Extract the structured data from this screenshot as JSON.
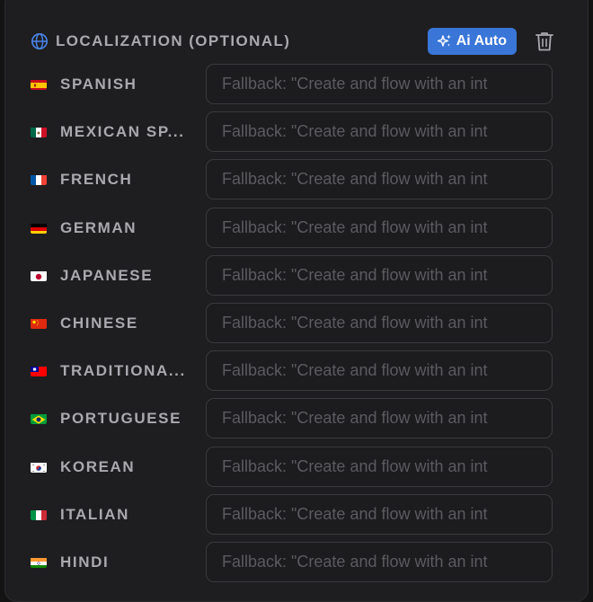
{
  "header": {
    "title": "LOCALIZATION (OPTIONAL)",
    "globe_icon": "globe-icon",
    "ai_button_label": "Ai Auto",
    "ai_button_icon": "sparkles-icon",
    "delete_icon": "trash-icon",
    "accent_color": "#3a76d8"
  },
  "languages": [
    {
      "name": "SPANISH",
      "flag": "es",
      "placeholder": "Fallback: \"Create and flow with an int",
      "value": ""
    },
    {
      "name": "MEXICAN SP...",
      "flag": "mx",
      "placeholder": "Fallback: \"Create and flow with an int",
      "value": ""
    },
    {
      "name": "FRENCH",
      "flag": "fr",
      "placeholder": "Fallback: \"Create and flow with an int",
      "value": ""
    },
    {
      "name": "GERMAN",
      "flag": "de",
      "placeholder": "Fallback: \"Create and flow with an int",
      "value": ""
    },
    {
      "name": "JAPANESE",
      "flag": "jp",
      "placeholder": "Fallback: \"Create and flow with an int",
      "value": ""
    },
    {
      "name": "CHINESE",
      "flag": "cn",
      "placeholder": "Fallback: \"Create and flow with an int",
      "value": ""
    },
    {
      "name": "TRADITIONA...",
      "flag": "tw",
      "placeholder": "Fallback: \"Create and flow with an int",
      "value": ""
    },
    {
      "name": "PORTUGUESE",
      "flag": "br",
      "placeholder": "Fallback: \"Create and flow with an int",
      "value": ""
    },
    {
      "name": "KOREAN",
      "flag": "kr",
      "placeholder": "Fallback: \"Create and flow with an int",
      "value": ""
    },
    {
      "name": "ITALIAN",
      "flag": "it",
      "placeholder": "Fallback: \"Create and flow with an int",
      "value": ""
    },
    {
      "name": "HINDI",
      "flag": "in",
      "placeholder": "Fallback: \"Create and flow with an int",
      "value": ""
    }
  ]
}
